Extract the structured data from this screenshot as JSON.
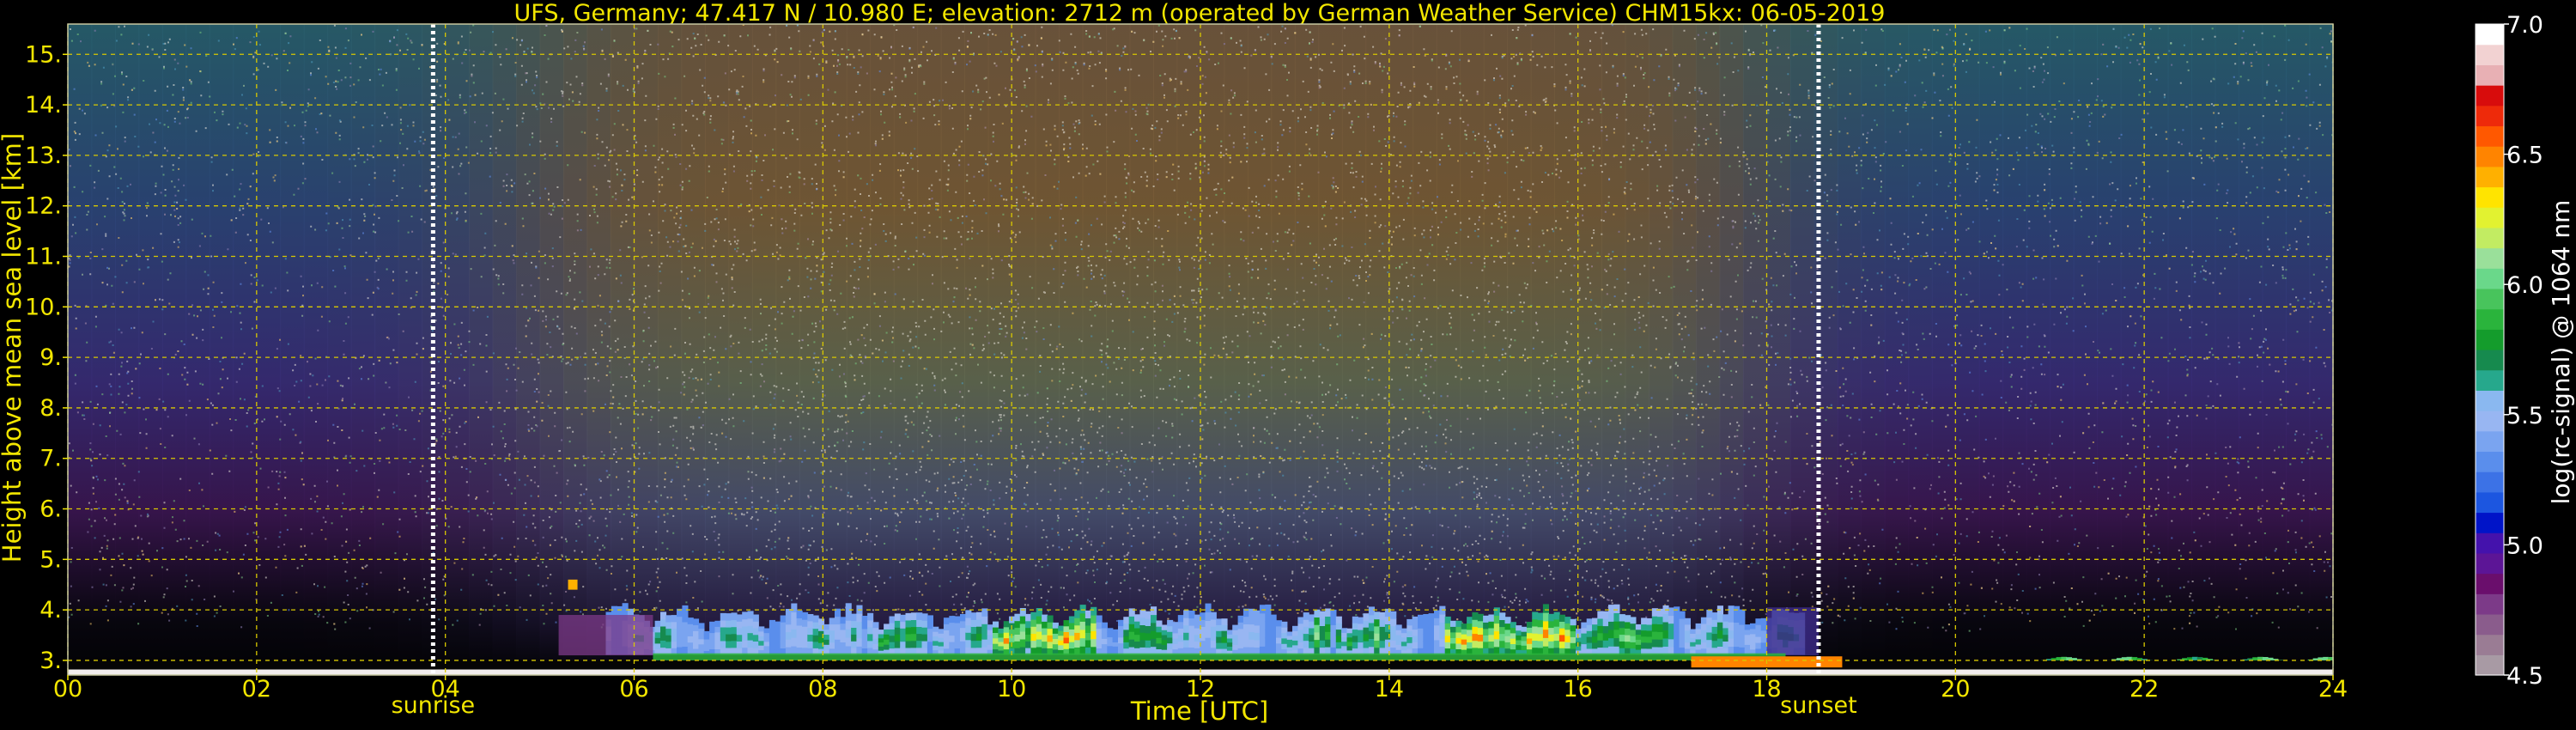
{
  "chart_data": {
    "type": "heatmap",
    "title": "UFS, Germany; 47.417 N / 10.980 E; elevation: 2712 m  (operated by German Weather Service)    CHM15kx: 06-05-2019",
    "xlabel": "Time [UTC]",
    "ylabel": "Height above mean sea level [km]",
    "xlim": [
      0,
      24
    ],
    "ylim": [
      2.71,
      15.6
    ],
    "x_ticks": [
      0,
      2,
      4,
      6,
      8,
      10,
      12,
      14,
      16,
      18,
      20,
      22,
      24
    ],
    "x_tick_labels": [
      "00",
      "02",
      "04",
      "06",
      "08",
      "10",
      "12",
      "14",
      "16",
      "18",
      "20",
      "22",
      "24"
    ],
    "y_ticks": [
      3,
      4,
      5,
      6,
      7,
      8,
      9,
      10,
      11,
      12,
      13,
      14,
      15
    ],
    "y_tick_labels": [
      "3.",
      "4.",
      "5.",
      "6.",
      "7.",
      "8.",
      "9.",
      "10.",
      "11.",
      "12.",
      "13.",
      "14.",
      "15."
    ],
    "grid": true,
    "events": [
      {
        "label": "sunrise",
        "time": 3.87
      },
      {
        "label": "sunset",
        "time": 18.55
      }
    ],
    "colorbar": {
      "label": "log(rc-signal) @ 1064 nm",
      "range": [
        4.5,
        7.0
      ],
      "ticks": [
        4.5,
        5.0,
        5.5,
        6.0,
        6.5,
        7.0
      ],
      "tick_labels": [
        "4.5",
        "5.0",
        "5.5",
        "6.0",
        "6.5",
        "7.0"
      ],
      "colors": [
        "#a89aa4",
        "#9a7c94",
        "#8a5c8c",
        "#7c3a88",
        "#6a0e6c",
        "#5c1596",
        "#4412ac",
        "#0014c8",
        "#1c56e0",
        "#3c72e6",
        "#5a8eec",
        "#7aa4f0",
        "#98b6f2",
        "#8ab8f0",
        "#26a88c",
        "#168a4e",
        "#149c2c",
        "#2ab43c",
        "#48c45c",
        "#6ad88a",
        "#9ae09a",
        "#c2ec62",
        "#e2f230",
        "#ffe400",
        "#ffb000",
        "#ff8400",
        "#ff5800",
        "#ee2a0a",
        "#d80c0c",
        "#e8b0b4",
        "#f2d2d2",
        "#ffffff"
      ]
    }
  }
}
